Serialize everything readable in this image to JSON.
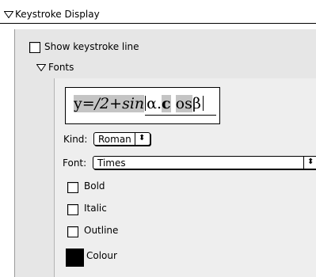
{
  "section": {
    "title": "Keystroke Display"
  },
  "show_line": {
    "label": "Show keystroke line",
    "checked": false
  },
  "fonts": {
    "title": "Fonts"
  },
  "preview": {
    "part1": "y=",
    "part2": "/2+sin",
    "part3": "α.",
    "part4": "c",
    "part5": "os",
    "part6": "β"
  },
  "kind": {
    "label": "Kind:",
    "value": "Roman",
    "arrows": "⬍"
  },
  "font": {
    "label": "Font:",
    "value": "Times",
    "arrows": "⬍"
  },
  "options": [
    {
      "label": "Bold",
      "checked": false
    },
    {
      "label": "Italic",
      "checked": false
    },
    {
      "label": "Outline",
      "checked": false
    }
  ],
  "colour": {
    "label": "Colour",
    "swatch": "#000000"
  }
}
